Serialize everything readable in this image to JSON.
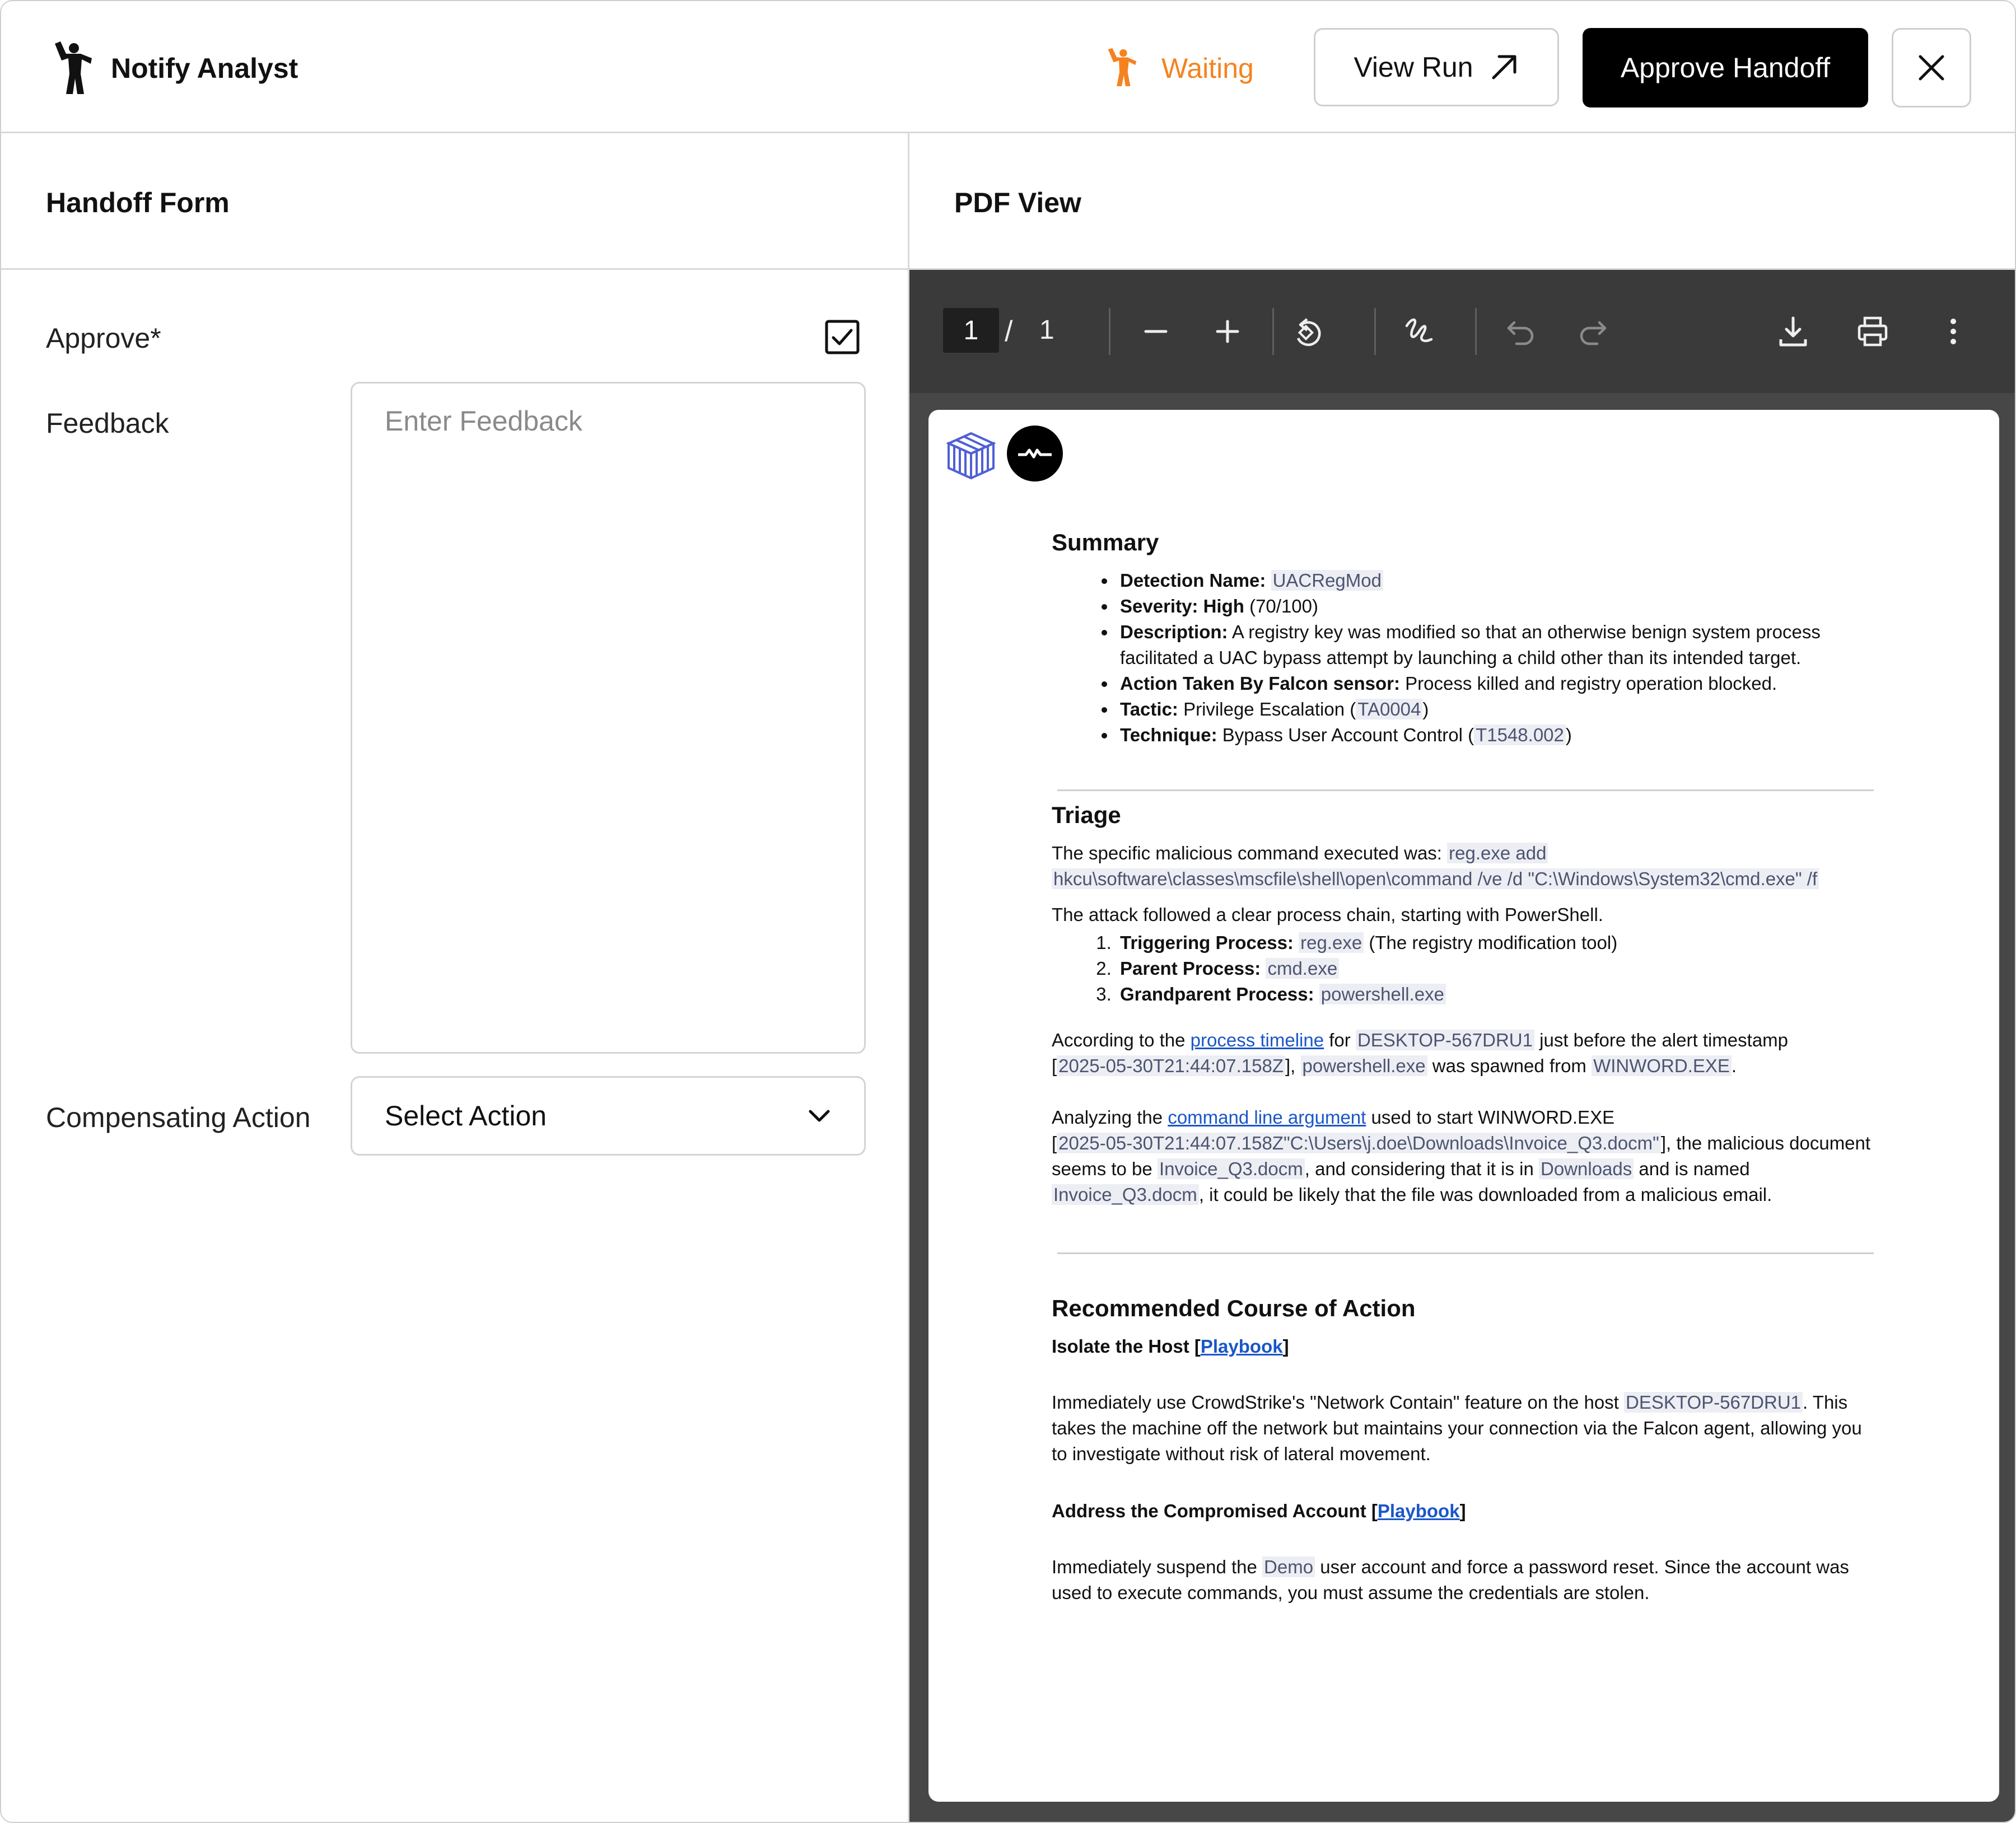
{
  "header": {
    "title": "Notify Analyst",
    "status": "Waiting",
    "view_run_label": "View Run",
    "approve_label": "Approve Handoff",
    "status_color": "#f5821f"
  },
  "form": {
    "title": "Handoff Form",
    "approve_label": "Approve*",
    "approve_checked": true,
    "feedback_label": "Feedback",
    "feedback_placeholder": "Enter Feedback",
    "action_label": "Compensating Action",
    "action_value": "Select Action"
  },
  "pdf": {
    "title": "PDF View",
    "page_current": "1",
    "page_sep": "/",
    "page_total": "1",
    "toolbar_icons": [
      "zoom-out-icon",
      "zoom-in-icon",
      "rotate-icon",
      "draw-icon",
      "undo-icon",
      "redo-icon",
      "download-icon",
      "print-icon",
      "more-icon"
    ],
    "summary": {
      "heading": "Summary",
      "detection_label": "Detection Name:",
      "detection_value": "UACRegMod",
      "severity_label": "Severity:",
      "severity_value": "High",
      "severity_score": "(70/100)",
      "description_label": "Description:",
      "description_value": "A registry key was modified so that an otherwise benign system process facilitated a UAC bypass attempt by launching a child other than its intended target.",
      "action_label": "Action Taken By Falcon sensor:",
      "action_value": "Process killed and registry operation blocked.",
      "tactic_label": "Tactic:",
      "tactic_value": "Privilege Escalation (",
      "tactic_code": "TA0004",
      "technique_label": "Technique:",
      "technique_value": "Bypass User Account Control (",
      "technique_code": "T1548.002",
      "close_paren": ")"
    },
    "triage": {
      "heading": "Triage",
      "cmd_intro": "The specific malicious command executed was:",
      "cmd_code_1": "reg.exe add",
      "cmd_code_2": "hkcu\\software\\classes\\mscfile\\shell\\open\\command /ve /d \"C:\\Windows\\System32\\cmd.exe\" /f",
      "chain_intro": "The attack followed a clear process chain, starting with PowerShell.",
      "chain": [
        {
          "label": "Triggering Process:",
          "code": "reg.exe",
          "note": " (The registry modification tool)"
        },
        {
          "label": "Parent Process:",
          "code": "cmd.exe",
          "note": ""
        },
        {
          "label": "Grandparent Process:",
          "code": "powershell.exe",
          "note": ""
        }
      ],
      "p1_a": "According to the ",
      "p1_link": "process timeline",
      "p1_b": " for ",
      "p1_host": "DESKTOP-567DRU1",
      "p1_c": " just before the alert timestamp",
      "p1_d": "[",
      "p1_ts": "2025-05-30T21:44:07.158Z",
      "p1_e": "], ",
      "p1_ps": "powershell.exe",
      "p1_f": " was spawned from ",
      "p1_word": "WINWORD.EXE",
      "p1_g": ".",
      "p2_a": "Analyzing the ",
      "p2_link": "command line argument",
      "p2_b": " used to start WINWORD.EXE",
      "p2_c": "[",
      "p2_code": "2025-05-30T21:44:07.158Z\"C:\\Users\\j.doe\\Downloads\\Invoice_Q3.docm\"",
      "p2_d": "], the malicious document seems to be ",
      "p2_doc": "Invoice_Q3.docm",
      "p2_e": ", and considering that it is in ",
      "p2_dl": "Downloads",
      "p2_f": " and is named ",
      "p2_doc2": "Invoice_Q3.docm",
      "p2_g": ", it could be likely that the file was downloaded from a malicious email."
    },
    "recommend": {
      "heading": "Recommended Course of Action",
      "isolate_title": "Isolate the Host [",
      "isolate_link": "Playbook",
      "bracket_close": "]",
      "isolate_a": "Immediately use CrowdStrike's \"Network Contain\" feature on the host ",
      "isolate_host": "DESKTOP-567DRU1",
      "isolate_b": ". This takes the machine off the network but maintains your connection via the Falcon agent, allowing you to investigate without risk of lateral movement.",
      "account_title": "Address the Compromised Account [",
      "account_link": "Playbook",
      "account_a": "Immediately suspend the ",
      "account_user": "Demo",
      "account_b": " user account and force a password reset. Since the account was used to execute commands, you must assume the credentials are stolen."
    }
  }
}
